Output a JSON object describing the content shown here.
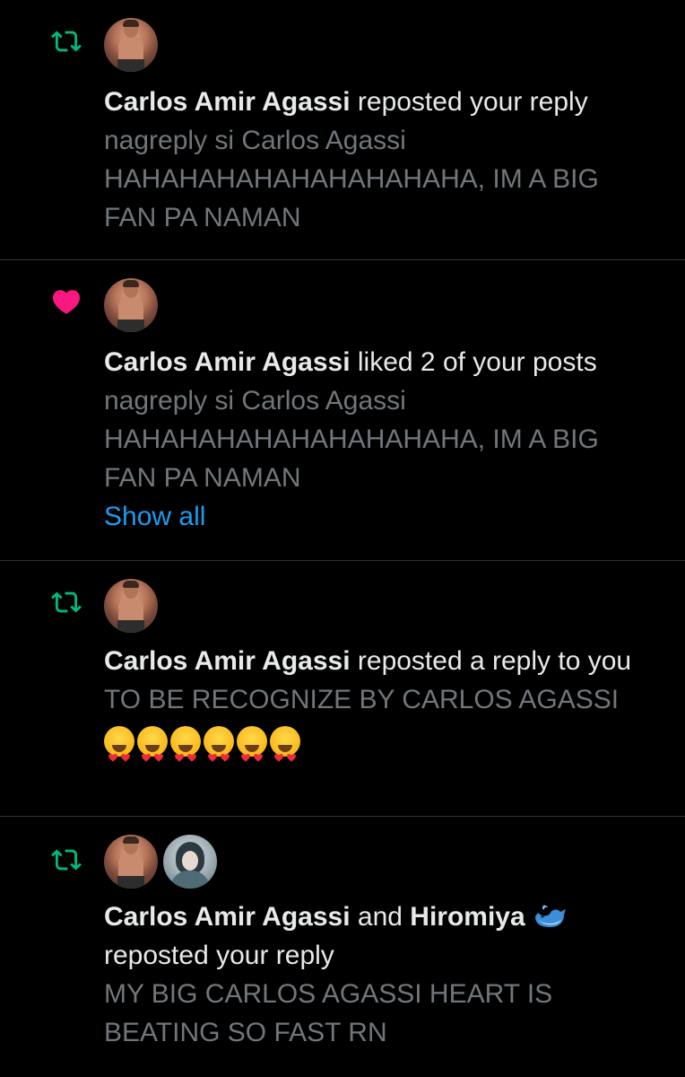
{
  "notifications": [
    {
      "type": "repost",
      "icon": "repost-icon",
      "headline_name": "Carlos Amir Agassi",
      "headline_rest": "reposted your reply",
      "body": "nagreply si Carlos Agassi HAHAHAHAHAHAHAHAHAHA, IM A BIG FAN PA NAMAN"
    },
    {
      "type": "like",
      "icon": "heart-icon",
      "headline_name": "Carlos Amir Agassi",
      "headline_rest": "liked 2 of your posts",
      "body": "nagreply si Carlos Agassi HAHAHAHAHAHAHAHAHAHA, IM A BIG FAN PA NAMAN",
      "show_all": "Show all"
    },
    {
      "type": "repost",
      "icon": "repost-icon",
      "headline_name": "Carlos Amir Agassi",
      "headline_rest": "reposted a reply to you",
      "body": "TO BE RECOGNIZE BY CARLOS AGASSI",
      "emoji": "smiling-face-with-heart-eyes",
      "emoji_count": 6
    },
    {
      "type": "repost",
      "icon": "repost-icon",
      "headline_name": "Carlos Amir Agassi",
      "headline_joiner": "and",
      "headline_name2": "Hiromiya",
      "headline_name2_emoji": "whale",
      "headline_rest": "reposted your reply",
      "body": "MY BIG CARLOS AGASSI HEART IS BEATING SO FAST RN"
    }
  ],
  "colors": {
    "background": "#000000",
    "primary_text": "#e7e9ea",
    "secondary_text": "#71767b",
    "repost_green": "#00ba7c",
    "like_pink": "#f91880",
    "link_blue": "#1d9bf0",
    "divider": "#2f3336"
  }
}
